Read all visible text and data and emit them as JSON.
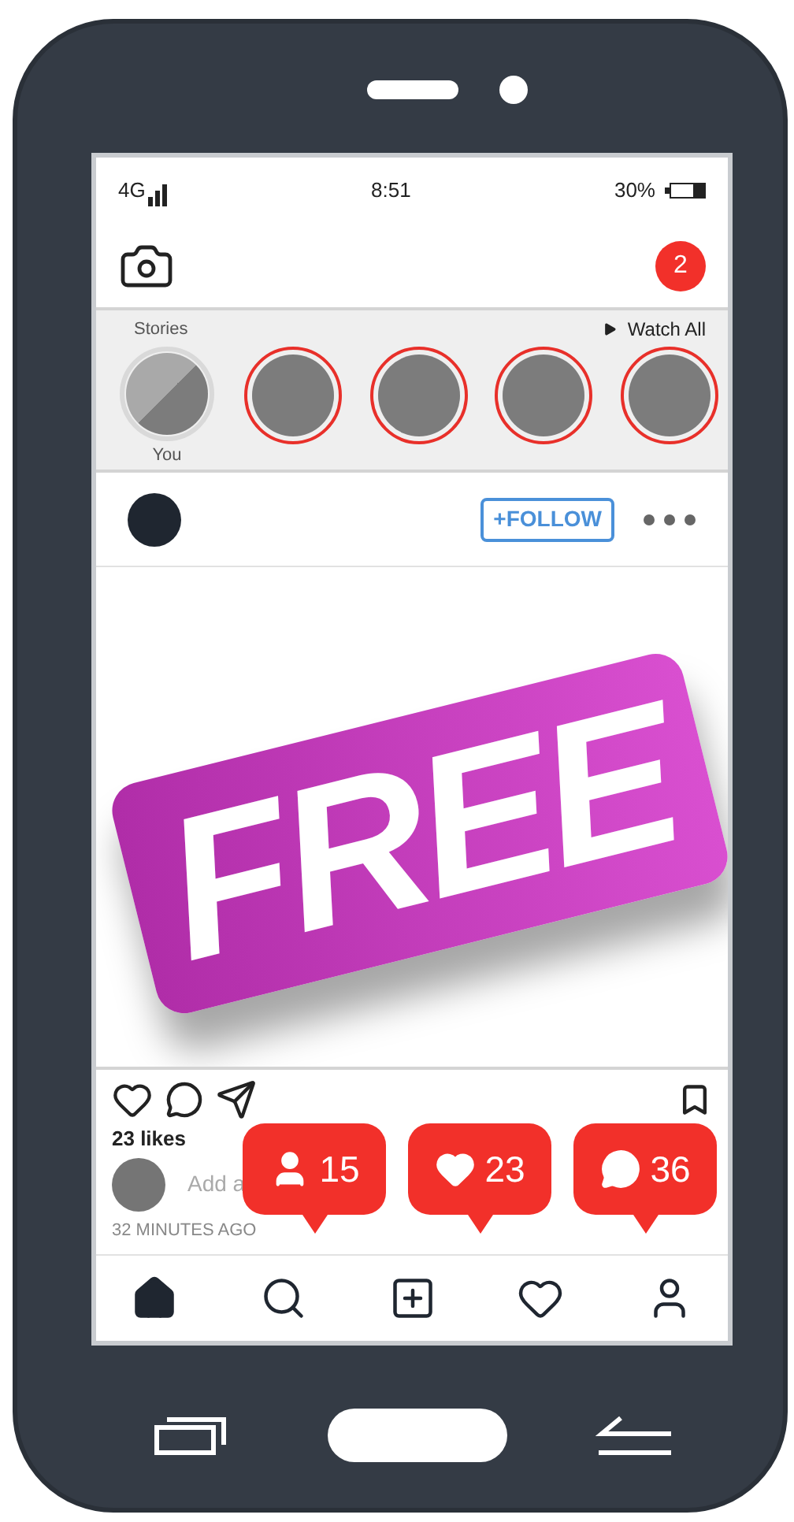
{
  "status_bar": {
    "network": "4G",
    "time": "8:51",
    "battery": "30%"
  },
  "header": {
    "notifications": "2"
  },
  "stories": {
    "title": "Stories",
    "watch_all": "Watch All",
    "items": [
      {
        "kind": "own",
        "label": "You"
      },
      {
        "kind": "story"
      },
      {
        "kind": "story"
      },
      {
        "kind": "story"
      },
      {
        "kind": "story"
      }
    ]
  },
  "post": {
    "follow": "+FOLLOW",
    "image_text": "FREE",
    "likes": "23 likes",
    "comment_placeholder": "Add a",
    "time": "32 MINUTES AGO"
  },
  "bubbles": [
    {
      "kind": "followers",
      "count": "15"
    },
    {
      "kind": "likes",
      "count": "23"
    },
    {
      "kind": "comments",
      "count": "36"
    }
  ],
  "nav": [
    {
      "kind": "home",
      "selected": true
    },
    {
      "kind": "search",
      "selected": false
    },
    {
      "kind": "add",
      "selected": false
    },
    {
      "kind": "activity",
      "selected": false
    },
    {
      "kind": "profile",
      "selected": false
    }
  ]
}
